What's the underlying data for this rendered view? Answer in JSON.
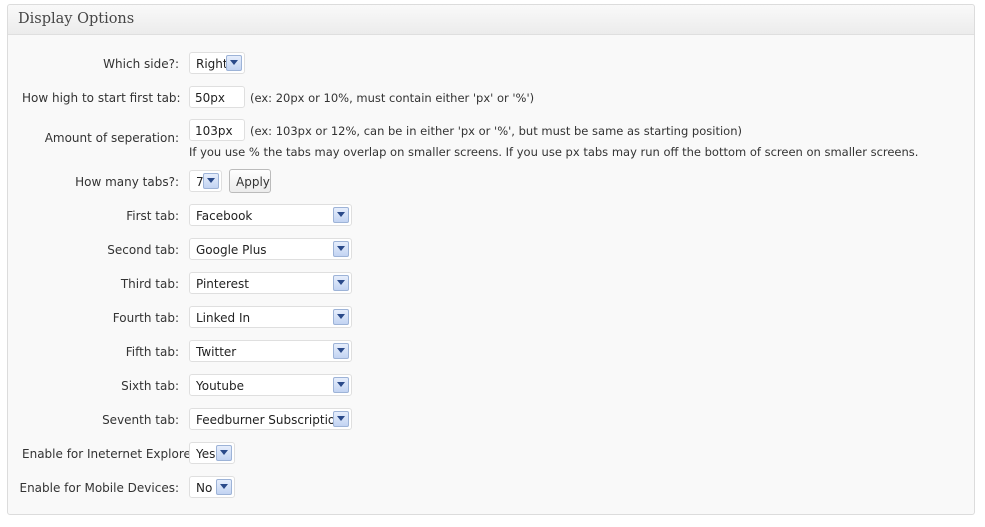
{
  "panel": {
    "title": "Display Options"
  },
  "side": {
    "label": "Which side?:",
    "value": "Right"
  },
  "start": {
    "label": "How high to start first tab:",
    "value": "50px",
    "hint": "(ex: 20px or 10%, must contain either 'px' or '%')"
  },
  "separation": {
    "label": "Amount of seperation:",
    "value": "103px",
    "hint": "(ex: 103px or 12%, can be in either 'px or '%', but must be same as starting position)",
    "note": "If you use % the tabs may overlap on smaller screens. If you use px tabs may run off the bottom of screen on smaller screens."
  },
  "count": {
    "label": "How many tabs?:",
    "value": "7",
    "apply_label": "Apply"
  },
  "tabs": [
    {
      "label": "First tab:",
      "value": "Facebook"
    },
    {
      "label": "Second tab:",
      "value": "Google Plus"
    },
    {
      "label": "Third tab:",
      "value": "Pinterest"
    },
    {
      "label": "Fourth tab:",
      "value": "Linked In"
    },
    {
      "label": "Fifth tab:",
      "value": "Twitter"
    },
    {
      "label": "Sixth tab:",
      "value": "Youtube"
    },
    {
      "label": "Seventh tab:",
      "value": "Feedburner Subscription"
    }
  ],
  "ie": {
    "label": "Enable for Ineternet Explorer:",
    "value": "Yes"
  },
  "mobile": {
    "label": "Enable for Mobile Devices:",
    "value": "No"
  }
}
